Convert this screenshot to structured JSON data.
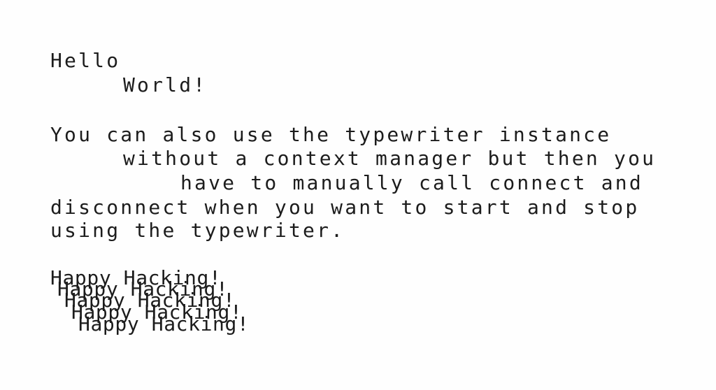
{
  "document": {
    "greeting": {
      "line_1": "Hello",
      "line_2": "World!"
    },
    "paragraph": {
      "line_1": "You can also use the typewriter instance",
      "line_2": "without a context manager but then you",
      "line_3": "have to manually call connect and",
      "line_4": "disconnect when you want to start and stop",
      "line_5": "using the typewriter."
    },
    "sign_off": {
      "repeat_1": "Happy Hacking!",
      "repeat_2": "Happy Hacking!",
      "repeat_3": "Happy Hacking!",
      "repeat_4": "Happy Hacking!",
      "repeat_5": "Happy Hacking!"
    }
  }
}
